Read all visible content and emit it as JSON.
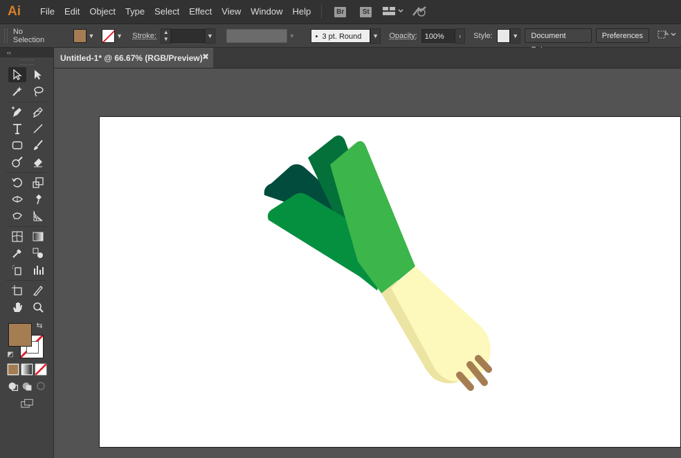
{
  "app": {
    "logo": "Ai",
    "logo_color": "#d47f2a"
  },
  "menu": {
    "items": [
      "File",
      "Edit",
      "Object",
      "Type",
      "Select",
      "Effect",
      "View",
      "Window",
      "Help"
    ],
    "bridge": "Br",
    "stock": "St"
  },
  "control": {
    "selection": "No Selection",
    "fill_color": "#a57d52",
    "stroke_label": "Stroke:",
    "brush": "3 pt. Round",
    "opacity_label": "Opacity:",
    "opacity_value": "100%",
    "style_label": "Style:",
    "document_setup": "Document Setup",
    "preferences": "Preferences"
  },
  "document": {
    "tab_title": "Untitled-1* @ 66.67% (RGB/Preview)",
    "close": "✖"
  },
  "artwork": {
    "subject": "leek illustration",
    "colors": {
      "dark_leaf": "#014c3d",
      "mid_dark_leaf": "#04703a",
      "green_leaf": "#059040",
      "light_leaf": "#3cb54a",
      "bulb": "#fdf8bc",
      "bulb_shade": "#ece4a2",
      "roots": "#a57d52"
    }
  },
  "tools": {
    "panel_head": "‹‹"
  }
}
